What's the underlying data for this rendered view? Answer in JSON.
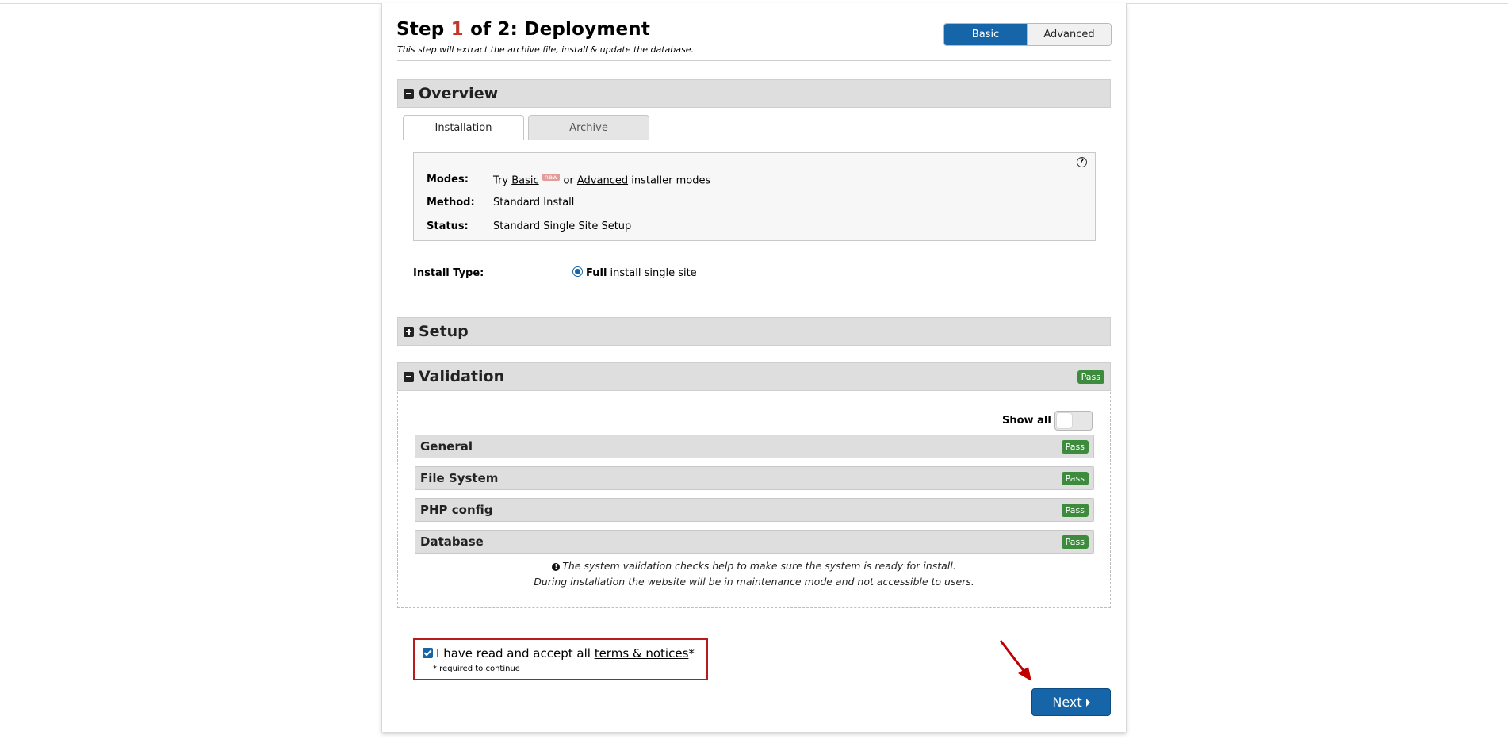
{
  "header": {
    "title_prefix": "Step ",
    "step_current": "1",
    "title_suffix": " of 2: Deployment",
    "subtitle": "This step will extract the archive file, install & update the database."
  },
  "mode_toggle": {
    "basic": "Basic",
    "advanced": "Advanced",
    "selected": "Basic"
  },
  "overview": {
    "title": "Overview",
    "tabs": [
      {
        "label": "Installation",
        "active": true
      },
      {
        "label": "Archive",
        "active": false
      }
    ],
    "rows": {
      "modes_label": "Modes:",
      "modes_try": "Try ",
      "modes_basic": "Basic",
      "modes_new": "new",
      "modes_or": " or ",
      "modes_advanced": "Advanced",
      "modes_suffix": " installer modes",
      "method_label": "Method:",
      "method_value": "Standard Install",
      "status_label": "Status:",
      "status_value": "Standard Single Site Setup"
    },
    "help_icon": "?",
    "install_type_label": "Install Type:",
    "install_option_bold": "Full",
    "install_option_rest": " install single site"
  },
  "setup": {
    "title": "Setup"
  },
  "validation": {
    "title": "Validation",
    "status": "Pass",
    "show_all_label": "Show all",
    "show_all_on": false,
    "items": [
      {
        "title": "General",
        "status": "Pass"
      },
      {
        "title": "File System",
        "status": "Pass"
      },
      {
        "title": "PHP config",
        "status": "Pass"
      },
      {
        "title": "Database",
        "status": "Pass"
      }
    ],
    "note_line1": "The system validation checks help to make sure the system is ready for install.",
    "note_line2": "During installation the website will be in maintenance mode and not accessible to users."
  },
  "terms": {
    "checked": true,
    "text": "I have read and accept all ",
    "link": "terms & notices",
    "asterisk": "*",
    "required_note": "* required to continue"
  },
  "next_button": {
    "label": "Next"
  },
  "colors": {
    "primary": "#1565a8",
    "pass": "#3d8b3d",
    "step_highlight": "#c0392b",
    "terms_border": "#b71c1c",
    "arrow": "#c00000"
  }
}
